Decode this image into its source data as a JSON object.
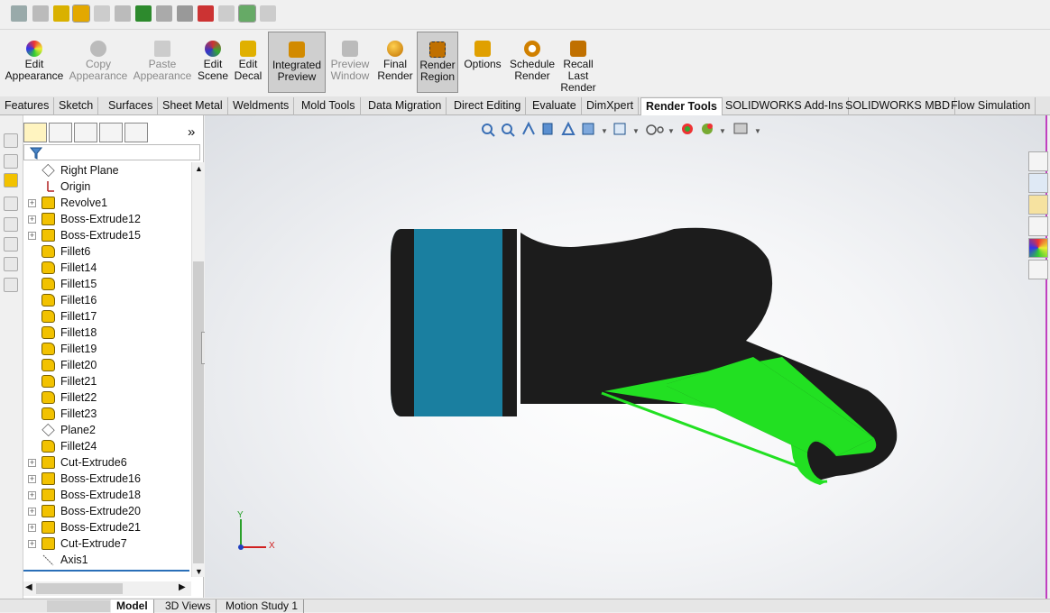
{
  "ribbon": {
    "buttons": [
      {
        "line1": "Edit",
        "line2": "Appearance",
        "line3": ""
      },
      {
        "line1": "Copy",
        "line2": "Appearance",
        "line3": ""
      },
      {
        "line1": "Paste",
        "line2": "Appearance",
        "line3": ""
      },
      {
        "line1": "Edit",
        "line2": "Scene",
        "line3": ""
      },
      {
        "line1": "Edit",
        "line2": "Decal",
        "line3": ""
      },
      {
        "line1": "Integrated",
        "line2": "Preview",
        "line3": ""
      },
      {
        "line1": "Preview",
        "line2": "Window",
        "line3": ""
      },
      {
        "line1": "Final",
        "line2": "Render",
        "line3": ""
      },
      {
        "line1": "Render",
        "line2": "Region",
        "line3": ""
      },
      {
        "line1": "Options",
        "line2": "",
        "line3": ""
      },
      {
        "line1": "Schedule",
        "line2": "Render",
        "line3": ""
      },
      {
        "line1": "Recall",
        "line2": "Last",
        "line3": "Render"
      }
    ]
  },
  "tabs": [
    "Features",
    "Sketch",
    "Surfaces",
    "Sheet Metal",
    "Weldments",
    "Mold Tools",
    "Data Migration",
    "Direct Editing",
    "Evaluate",
    "DimXpert",
    "Render Tools",
    "SOLIDWORKS Add-Ins",
    "SOLIDWORKS MBD",
    "Flow Simulation"
  ],
  "active_tab": "Render Tools",
  "feature_tree": {
    "items": [
      {
        "label": "Right Plane"
      },
      {
        "label": "Origin"
      },
      {
        "label": "Revolve1"
      },
      {
        "label": "Boss-Extrude12"
      },
      {
        "label": "Boss-Extrude15"
      },
      {
        "label": "Fillet6"
      },
      {
        "label": "Fillet14"
      },
      {
        "label": "Fillet15"
      },
      {
        "label": "Fillet16"
      },
      {
        "label": "Fillet17"
      },
      {
        "label": "Fillet18"
      },
      {
        "label": "Fillet19"
      },
      {
        "label": "Fillet20"
      },
      {
        "label": "Fillet21"
      },
      {
        "label": "Fillet22"
      },
      {
        "label": "Fillet23"
      },
      {
        "label": "Plane2"
      },
      {
        "label": "Fillet24"
      },
      {
        "label": "Cut-Extrude6"
      },
      {
        "label": "Boss-Extrude16"
      },
      {
        "label": "Boss-Extrude18"
      },
      {
        "label": "Boss-Extrude20"
      },
      {
        "label": "Boss-Extrude21"
      },
      {
        "label": "Cut-Extrude7"
      },
      {
        "label": "Axis1"
      }
    ],
    "more_label": "»"
  },
  "triad": {
    "x": "X",
    "y": "Y"
  },
  "bottom_tabs": [
    "Model",
    "3D Views",
    "Motion Study 1"
  ],
  "colors": {
    "accent_green": "#22e022",
    "body_teal": "#1a7fa0",
    "body_black": "#1c1c1c"
  }
}
